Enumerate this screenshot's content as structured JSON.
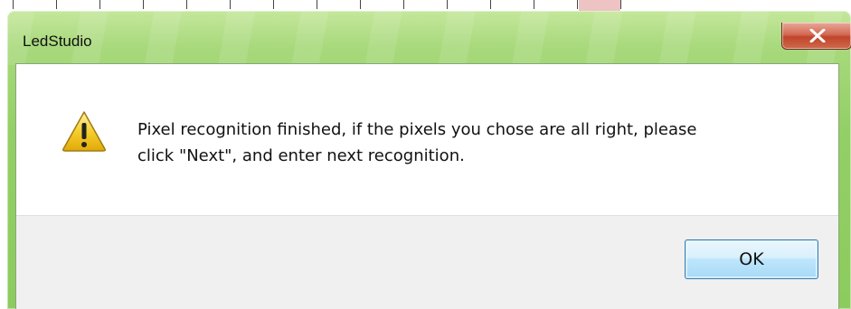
{
  "window": {
    "title": "LedStudio",
    "close_glyph": "X"
  },
  "dialog": {
    "icon": "warning-icon",
    "message_line1": "Pixel recognition finished, if the pixels you chose are all right, please",
    "message_line2": "click \"Next\", and enter next recognition.",
    "ok_label": "OK"
  },
  "colors": {
    "frame_accent": "#93cf66",
    "close_button": "#c0452c",
    "ok_border": "#3c7fb1",
    "warning_yellow": "#f2c319"
  }
}
